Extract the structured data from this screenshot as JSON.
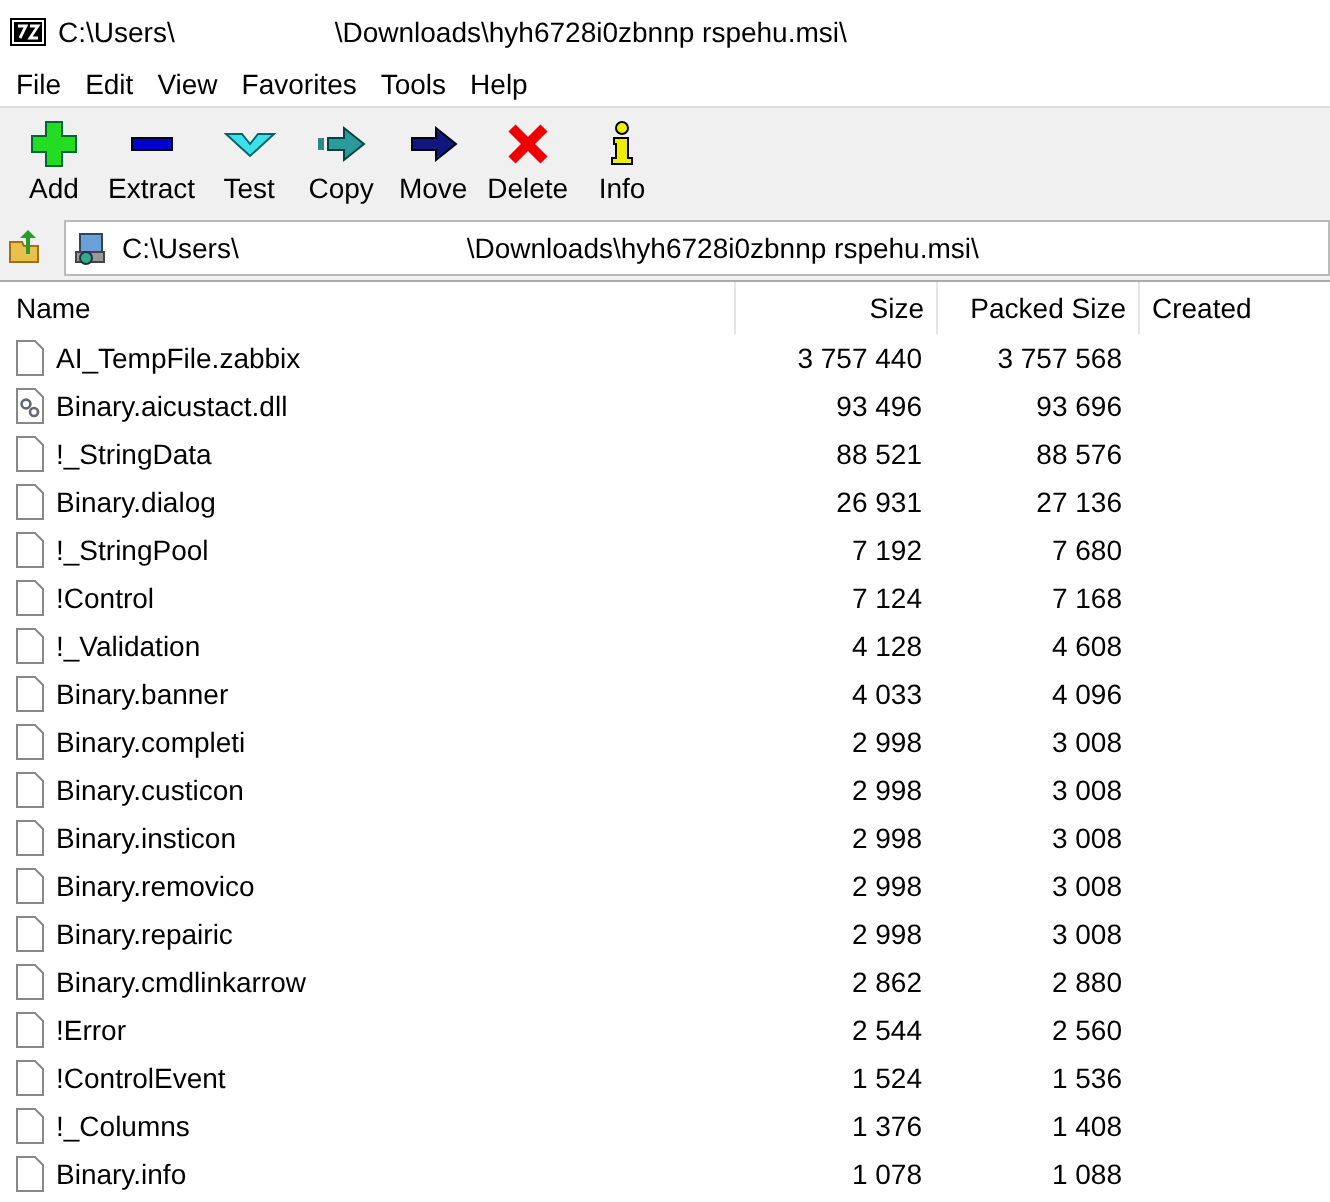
{
  "window": {
    "title_parts": [
      "C:\\Users\\",
      "\\Downloads\\hyh6728i0zbnnp rspehu.msi\\"
    ]
  },
  "menu": [
    "File",
    "Edit",
    "View",
    "Favorites",
    "Tools",
    "Help"
  ],
  "toolbar": [
    {
      "kind": "add",
      "label": "Add"
    },
    {
      "kind": "extract",
      "label": "Extract"
    },
    {
      "kind": "test",
      "label": "Test"
    },
    {
      "kind": "copy",
      "label": "Copy"
    },
    {
      "kind": "move",
      "label": "Move"
    },
    {
      "kind": "delete",
      "label": "Delete"
    },
    {
      "kind": "info",
      "label": "Info"
    }
  ],
  "address": {
    "parts": [
      "C:\\Users\\",
      "\\Downloads\\hyh6728i0zbnnp rspehu.msi\\"
    ]
  },
  "table": {
    "columns": [
      "Name",
      "Size",
      "Packed Size",
      "Created"
    ],
    "rows": [
      {
        "kind": "file",
        "name": "AI_TempFile.zabbix",
        "size": "3 757 440",
        "packed": "3 757 568"
      },
      {
        "kind": "dll",
        "name": "Binary.aicustact.dll",
        "size": "93 496",
        "packed": "93 696"
      },
      {
        "kind": "file",
        "name": "!_StringData",
        "size": "88 521",
        "packed": "88 576"
      },
      {
        "kind": "file",
        "name": "Binary.dialog",
        "size": "26 931",
        "packed": "27 136"
      },
      {
        "kind": "file",
        "name": "!_StringPool",
        "size": "7 192",
        "packed": "7 680"
      },
      {
        "kind": "file",
        "name": "!Control",
        "size": "7 124",
        "packed": "7 168"
      },
      {
        "kind": "file",
        "name": "!_Validation",
        "size": "4 128",
        "packed": "4 608"
      },
      {
        "kind": "file",
        "name": "Binary.banner",
        "size": "4 033",
        "packed": "4 096"
      },
      {
        "kind": "file",
        "name": "Binary.completi",
        "size": "2 998",
        "packed": "3 008"
      },
      {
        "kind": "file",
        "name": "Binary.custicon",
        "size": "2 998",
        "packed": "3 008"
      },
      {
        "kind": "file",
        "name": "Binary.insticon",
        "size": "2 998",
        "packed": "3 008"
      },
      {
        "kind": "file",
        "name": "Binary.removico",
        "size": "2 998",
        "packed": "3 008"
      },
      {
        "kind": "file",
        "name": "Binary.repairic",
        "size": "2 998",
        "packed": "3 008"
      },
      {
        "kind": "file",
        "name": "Binary.cmdlinkarrow",
        "size": "2 862",
        "packed": "2 880"
      },
      {
        "kind": "file",
        "name": "!Error",
        "size": "2 544",
        "packed": "2 560"
      },
      {
        "kind": "file",
        "name": "!ControlEvent",
        "size": "1 524",
        "packed": "1 536"
      },
      {
        "kind": "file",
        "name": "!_Columns",
        "size": "1 376",
        "packed": "1 408"
      },
      {
        "kind": "file",
        "name": "Binary.info",
        "size": "1 078",
        "packed": "1 088"
      }
    ]
  }
}
